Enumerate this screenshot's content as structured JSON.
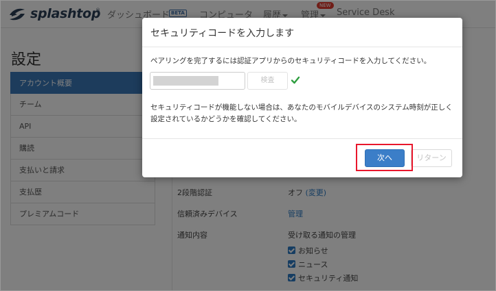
{
  "header": {
    "logo_text": "splashtop",
    "logo_tm": "®",
    "nav_dashboard": "ダッシュボード",
    "beta_badge": "BETA",
    "nav_computers": "コンピュータ",
    "nav_history": "履歴",
    "nav_admin": "管理",
    "new_badge": "NEW",
    "nav_service_desk": "Service Desk"
  },
  "page": {
    "title": "設定"
  },
  "sidebar": {
    "items": [
      {
        "label": "アカウント概要",
        "active": true
      },
      {
        "label": "チーム"
      },
      {
        "label": "API"
      },
      {
        "label": "購読"
      },
      {
        "label": "支払いと請求"
      },
      {
        "label": "支払歴"
      },
      {
        "label": "プレミアムコード"
      }
    ]
  },
  "settings": {
    "two_factor_label": "2段階認証",
    "two_factor_value": "オフ",
    "two_factor_link": "(変更)",
    "trusted_devices_label": "信頼済みデバイス",
    "trusted_devices_link": "管理",
    "notifications_label": "通知内容",
    "notifications_value": "受け取る通知の管理",
    "notification_options": [
      "お知らせ",
      "ニュース",
      "セキュリティ通知"
    ]
  },
  "modal": {
    "title": "セキュリティコードを入力します",
    "instruction": "ペアリングを完了するには認証アプリからのセキュリティコードを入力してください。",
    "verify_label": "検査",
    "note": "セキュリティコードが機能しない場合は、あなたのモバイルデバイスのシステム時刻が正しく設定されているかどうかを確認してください。",
    "next_label": "次へ",
    "return_label": "リターン",
    "accent_color": "#3b7ec8",
    "highlight_color": "#e8162b"
  }
}
